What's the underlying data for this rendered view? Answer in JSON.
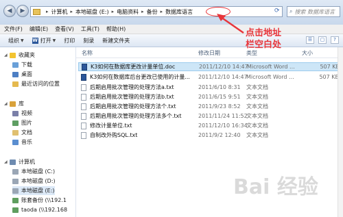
{
  "address": {
    "segments": [
      "计算机",
      "本地磁盘 (E:)",
      "电脑资料",
      "备份",
      "数据库语言"
    ]
  },
  "search": {
    "placeholder": "搜索 数据库语言"
  },
  "menu": [
    "文件(F)",
    "编辑(E)",
    "查看(V)",
    "工具(T)",
    "帮助(H)"
  ],
  "toolbar": {
    "organize": "组织",
    "open": "打开",
    "print": "打印",
    "burn": "刻录",
    "new_folder": "新建文件夹"
  },
  "sidebar": {
    "favorites": "收藏夹",
    "favorites_items": [
      "下载",
      "桌面",
      "最近访问的位置"
    ],
    "libraries": "库",
    "libraries_items": [
      "视频",
      "图片",
      "文档",
      "音乐"
    ],
    "computer": "计算机",
    "computer_items": [
      "本地磁盘 (C:)",
      "本地磁盘 (D:)",
      "本地磁盘 (E:)",
      "账套备份 (\\\\192.1",
      "taoda (\\\\192.168"
    ]
  },
  "columns": {
    "name": "名称",
    "date": "修改日期",
    "type": "类型",
    "size": "大小"
  },
  "files": [
    {
      "name": "K3如何在数据库更改计量单位.doc",
      "date": "2011/12/10 14:47",
      "type": "Microsoft Word ...",
      "size": "507 KB",
      "icon": "word-doc-icon"
    },
    {
      "name": "K3如何在数据库后台更改已使用的计量...",
      "date": "2011/12/10 14:47",
      "type": "Microsoft Word ...",
      "size": "507 KB",
      "icon": "word-doc-icon"
    },
    {
      "name": "后期启用批次管理的处理方法a.txt",
      "date": "2011/6/10 8:31",
      "type": "文本文档",
      "size": "",
      "icon": "text-file-icon"
    },
    {
      "name": "后期启用批次管理的处理方法b.txt",
      "date": "2011/6/15 9:51",
      "type": "文本文档",
      "size": "",
      "icon": "text-file-icon"
    },
    {
      "name": "后期启用批次管理的处理方法个.txt",
      "date": "2011/9/23 8:52",
      "type": "文本文档",
      "size": "",
      "icon": "text-file-icon"
    },
    {
      "name": "后期启用批次管理的处理方法多个.txt",
      "date": "2011/11/24 11:52",
      "type": "文本文档",
      "size": "",
      "icon": "text-file-icon"
    },
    {
      "name": "修改计量单位.txt",
      "date": "2011/12/10 16:34",
      "type": "文本文档",
      "size": "",
      "icon": "text-file-icon"
    },
    {
      "name": "自制改外购SQL.txt",
      "date": "2011/9/2 12:40",
      "type": "文本文档",
      "size": "",
      "icon": "text-file-icon"
    }
  ],
  "annotation": {
    "line1": "点击地址",
    "line2": "栏空白处"
  },
  "watermark": "Bai 经验",
  "colors": {
    "annotation": "#e8353a",
    "accent": "#3e6bb3"
  }
}
